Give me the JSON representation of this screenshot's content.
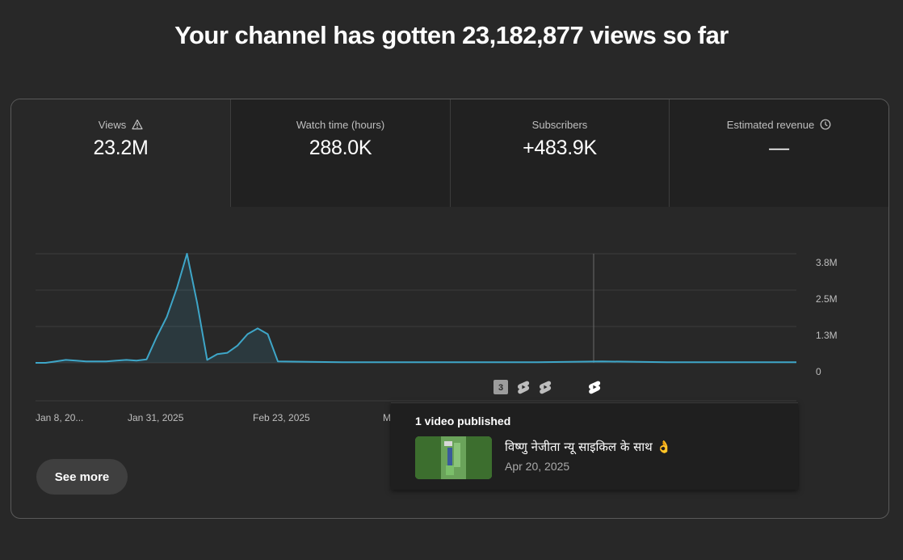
{
  "headline": "Your channel has gotten 23,182,877 views so far",
  "tabs": [
    {
      "label": "Views",
      "value": "23.2M",
      "icon": "warning-icon"
    },
    {
      "label": "Watch time (hours)",
      "value": "288.0K"
    },
    {
      "label": "Subscribers",
      "value": "+483.9K"
    },
    {
      "label": "Estimated revenue",
      "value": "—",
      "icon": "clock-icon"
    }
  ],
  "chart": {
    "y_ticks": [
      "3.8M",
      "2.5M",
      "1.3M",
      "0"
    ],
    "x_ticks": [
      "Jan 8, 20...",
      "Jan 31, 2025",
      "Feb 23, 2025",
      "M"
    ],
    "line_color": "#3ea6c8",
    "markers": [
      {
        "type": "badge",
        "label": "3"
      },
      {
        "type": "shorts"
      },
      {
        "type": "shorts"
      },
      {
        "type": "shorts"
      }
    ]
  },
  "chart_data": {
    "type": "line",
    "x": [
      "Jan 8",
      "Jan 10",
      "Jan 12",
      "Jan 14",
      "Jan 16",
      "Jan 18",
      "Jan 20",
      "Jan 22",
      "Jan 24",
      "Jan 26",
      "Jan 28",
      "Jan 30",
      "Feb 1",
      "Feb 3",
      "Feb 5",
      "Feb 7",
      "Feb 9",
      "Feb 11",
      "Feb 13",
      "Feb 15",
      "Feb 17",
      "Feb 19",
      "Feb 21",
      "Feb 23",
      "Feb 25",
      "Mar 1",
      "Mar 15",
      "Apr 1",
      "Apr 15",
      "Apr 20",
      "May 1",
      "May 15",
      "Jun 1"
    ],
    "series": [
      {
        "values": [
          0,
          0,
          0.05,
          0.1,
          0.08,
          0.05,
          0.05,
          0.05,
          0.08,
          0.1,
          0.08,
          0.12,
          0.9,
          1.6,
          2.6,
          3.8,
          2.1,
          0.1,
          0.3,
          0.35,
          0.6,
          1.0,
          1.2,
          1.0,
          0.05,
          0.02,
          0.02,
          0.02,
          0.02,
          0.05,
          0.02,
          0.02,
          0.02
        ]
      }
    ],
    "ylim": [
      0,
      3.8
    ],
    "y_unit": "M",
    "y_ticks": [
      "0",
      "1.3M",
      "2.5M",
      "3.8M"
    ]
  },
  "see_more": "See more",
  "popup": {
    "title": "1 video published",
    "video_title": "विष्णु नेजीता न्यू साइकिल के साथ 👌",
    "date": "Apr 20, 2025"
  }
}
